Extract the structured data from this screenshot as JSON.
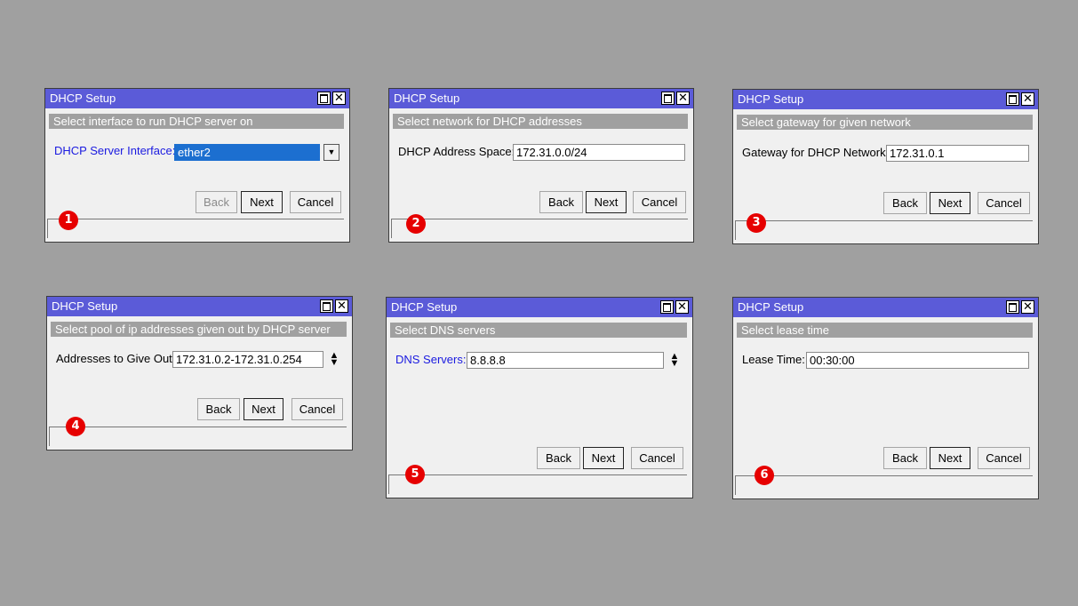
{
  "dialogs": [
    {
      "title": "DHCP Setup",
      "subtitle": "Select interface to run DHCP server on",
      "field_label": "DHCP Server Interface:",
      "field_value": "ether2",
      "back": "Back",
      "next": "Next",
      "cancel": "Cancel",
      "step": "1"
    },
    {
      "title": "DHCP Setup",
      "subtitle": "Select network for DHCP addresses",
      "field_label": "DHCP Address Space:",
      "field_value": "172.31.0.0/24",
      "back": "Back",
      "next": "Next",
      "cancel": "Cancel",
      "step": "2"
    },
    {
      "title": "DHCP Setup",
      "subtitle": "Select gateway for given network",
      "field_label": "Gateway for DHCP Network:",
      "field_value": "172.31.0.1",
      "back": "Back",
      "next": "Next",
      "cancel": "Cancel",
      "step": "3"
    },
    {
      "title": "DHCP Setup",
      "subtitle": "Select pool of ip addresses given out by DHCP server",
      "field_label": "Addresses to Give Out:",
      "field_value": "172.31.0.2-172.31.0.254",
      "back": "Back",
      "next": "Next",
      "cancel": "Cancel",
      "step": "4"
    },
    {
      "title": "DHCP Setup",
      "subtitle": "Select DNS servers",
      "field_label": "DNS Servers:",
      "field_value": "8.8.8.8",
      "back": "Back",
      "next": "Next",
      "cancel": "Cancel",
      "step": "5"
    },
    {
      "title": "DHCP Setup",
      "subtitle": "Select lease time",
      "field_label": "Lease Time:",
      "field_value": "00:30:00",
      "back": "Back",
      "next": "Next",
      "cancel": "Cancel",
      "step": "6"
    }
  ],
  "icons": {
    "maximize": "maximize-icon",
    "close": "close-icon",
    "dropdown": "dropdown-arrow-icon",
    "spin": "spin-updown-icon"
  },
  "colors": {
    "titlebar": "#5b5bd8",
    "subtitle_bar": "#a0a0a0",
    "badge": "#e60000",
    "blue_label": "#1a1ae0"
  }
}
